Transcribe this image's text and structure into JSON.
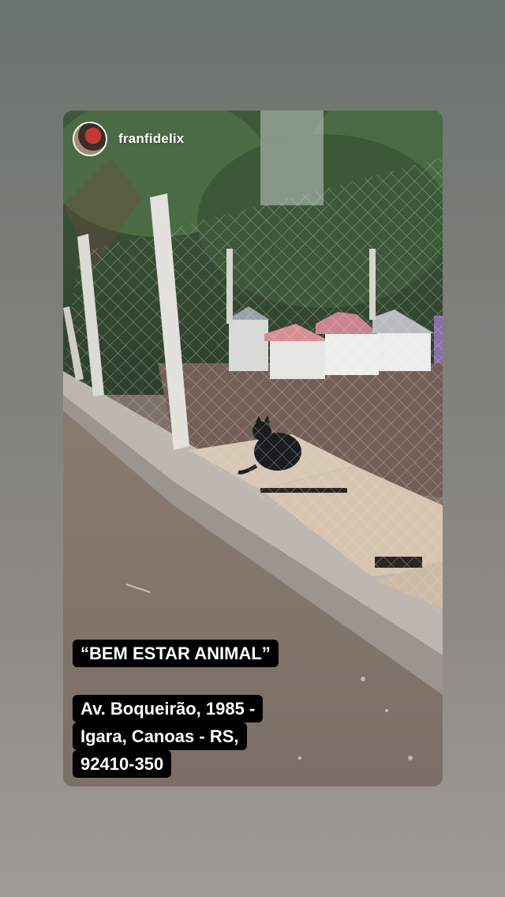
{
  "story": {
    "username": "franfidelix",
    "caption_title": "“BEM ESTAR ANIMAL”",
    "address_lines": [
      "Av. Boqueirão, 1985 -",
      "Igara, Canoas - RS,",
      "92410-350"
    ]
  },
  "icons": {
    "avatar": "profile-avatar"
  },
  "colors": {
    "caption_background": "#000000",
    "caption_text": "#ffffff"
  }
}
